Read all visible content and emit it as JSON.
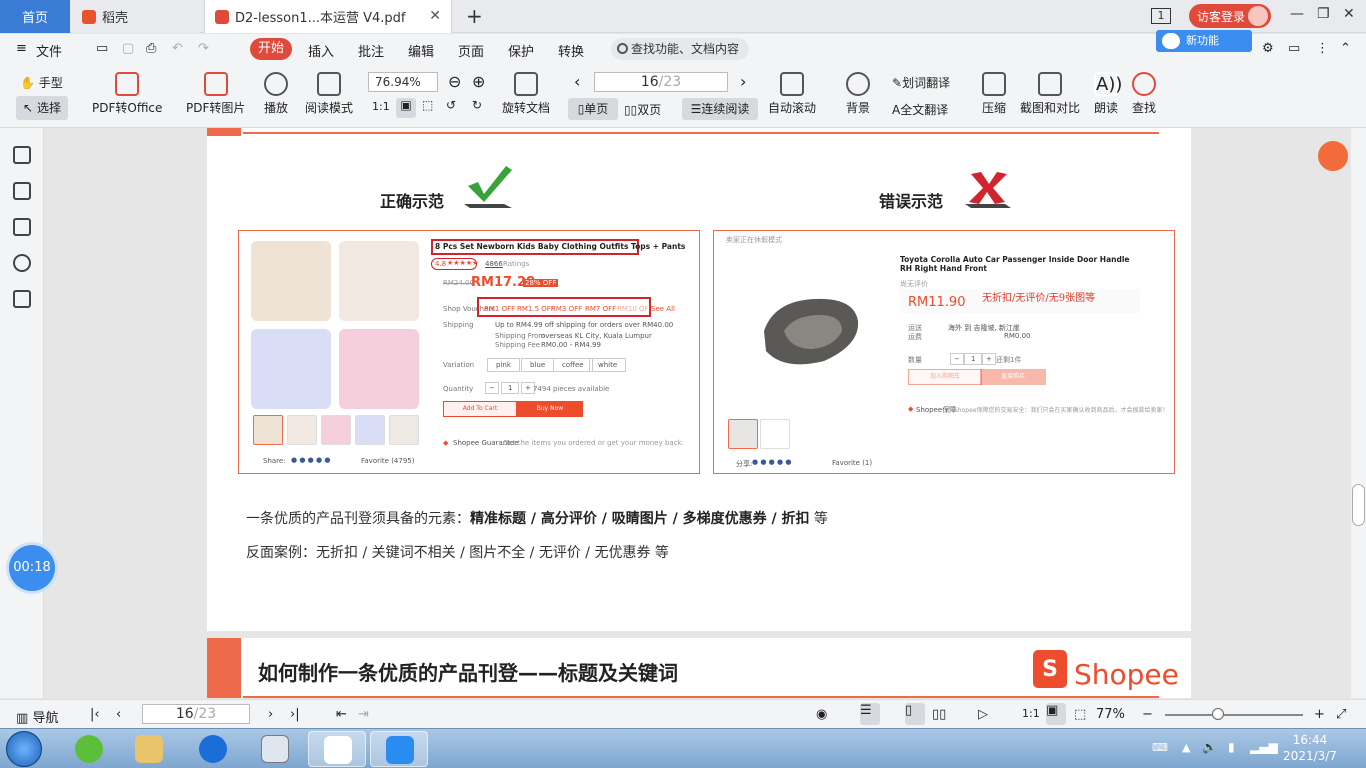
{
  "tabs": {
    "home": "首页",
    "daoke": "稻壳",
    "pdf": "D2-lesson1...本运营 V4.pdf",
    "new_tab": "+"
  },
  "window": {
    "page_indicator": "1",
    "login": "访客登录",
    "minimize": "—",
    "restore": "❐",
    "close": "✕"
  },
  "menubar": {
    "file": "文件",
    "items": [
      "开始",
      "插入",
      "批注",
      "编辑",
      "页面",
      "保护",
      "转换"
    ],
    "search": "查找功能、文档内容",
    "cloud_badge": "新功能"
  },
  "toolbar": {
    "hand": "手型",
    "select": "选择",
    "pdf_office": "PDF转Office",
    "pdf_image": "PDF转图片",
    "play": "播放",
    "read_mode": "阅读模式",
    "zoom": "76.94%",
    "page": "16",
    "page_total": "/23",
    "rotate": "旋转文档",
    "single": "单页",
    "double": "双页",
    "continuous": "连续阅读",
    "auto_scroll": "自动滚动",
    "background": "背景",
    "word_translate": "划词翻译",
    "full_translate": "全文翻译",
    "compress": "压缩",
    "compare": "截图和对比",
    "read_aloud": "朗读",
    "find": "查找",
    "actual_size": "1:1"
  },
  "timer": "00:18",
  "page1": {
    "correct_label": "正确示范",
    "wrong_label": "错误示范",
    "left_panel": {
      "product_title": "8 Pcs Set Newborn Kids Baby Clothing Outfits Tops + Pants",
      "rating": "4.8",
      "ratings_count": "4866",
      "ratings_label": "Ratings",
      "old_price": "RM24.00",
      "price": "RM17.28",
      "discount": "28% OFF",
      "voucher_label": "Shop Vouchers",
      "vouchers": [
        "RM1 OFF",
        "RM1.5 OFF",
        "RM3 OFF",
        "RM7 OFF",
        "RM10 OFF"
      ],
      "see_all": "See All",
      "shipping_label": "Shipping",
      "free_shipping": "Up to RM4.99 off shipping for orders over RM40.00",
      "shipping_from": "Shipping From",
      "shipping_from_value": "overseas KL City, Kuala Lumpur",
      "shipping_fee": "Shipping Fee",
      "shipping_fee_value": "RM0.00 - RM4.99",
      "variation_label": "Variation",
      "variations": [
        "pink",
        "blue",
        "coffee",
        "white"
      ],
      "quantity_label": "Quantity",
      "quantity": "1",
      "stock": "7494 pieces available",
      "add_to_cart": "Add To Cart",
      "buy_now": "Buy Now",
      "guarantee": "Shopee Guarantee",
      "guarantee_text": "Get the items you ordered or get your money back.",
      "share": "Share:",
      "favorite": "Favorite (4795)"
    },
    "right_panel": {
      "top_note": "卖家正在休假模式",
      "product_title": "Toyota Corolla Auto Car Passenger Inside Door Handle RH Right Hand Front",
      "no_rating": "尚无评价",
      "price": "RM11.90",
      "annotation": "无折扣/无评价/无9张图等",
      "shipping_label": "运送",
      "shipping_value": "海外 到 吉隆坡, 新江崖",
      "fee_label": "运费",
      "fee_value": "RM0.00",
      "qty_label": "数量",
      "qty": "1",
      "stock": "还剩1件",
      "cart": "加入购物车",
      "buy": "直接购买",
      "guarantee": "Shopee保障",
      "guarantee_text": "Shopee保障您的交易安全：我们只会在买家确认收到商品后，才会拨款给卖家！",
      "share": "分享:",
      "favorite": "Favorite (1)"
    },
    "line1_prefix": "一条优质的产品刊登须具备的元素：",
    "line1_bold": "精准标题 / 高分评价 / 吸睛图片 / 多梯度优惠券 / 折扣",
    "line1_suffix": " 等",
    "line2": "反面案例：无折扣 / 关键词不相关 / 图片不全 / 无评价 / 无优惠券 等"
  },
  "page2": {
    "title": "如何制作一条优质的产品刊登——标题及关键词",
    "logo_text": "Shopee",
    "logo_glyph": "S"
  },
  "statusbar": {
    "nav": "导航",
    "page": "16",
    "page_total": "/23",
    "zoom": "77%",
    "actual": "1:1"
  },
  "taskbar": {
    "time": "16:44",
    "date": "2021/3/7"
  },
  "colors": {
    "accent": "#ef6a4b",
    "brand_red": "#e04a3a",
    "shopee": "#ee4d2d",
    "home_tab": "#3a7bd5"
  }
}
